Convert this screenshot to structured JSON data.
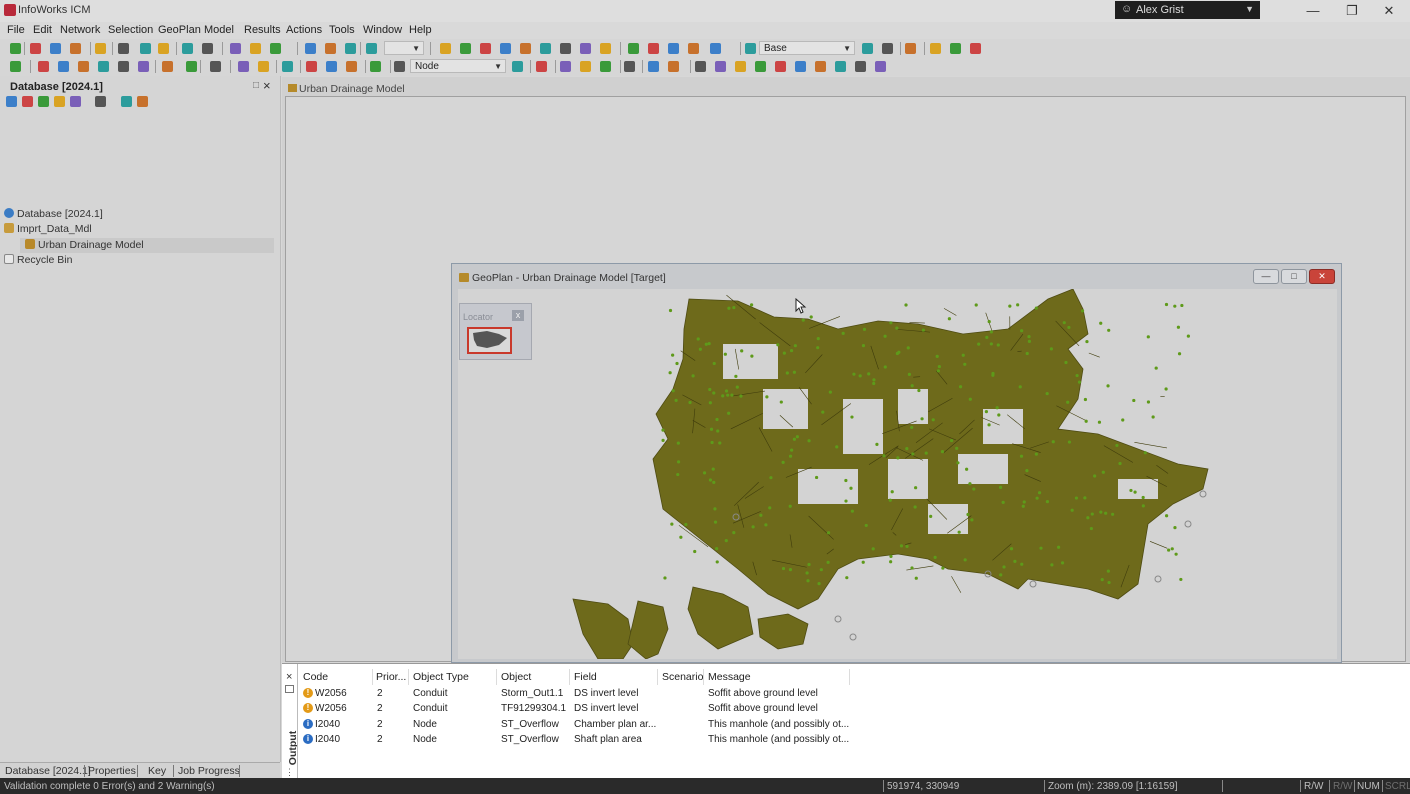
{
  "titlebar": {
    "title": "InfoWorks ICM",
    "user": "Alex Grist",
    "controls": [
      "—",
      "❐",
      "✕"
    ]
  },
  "menu": [
    "File",
    "Edit",
    "Network",
    "Selection",
    "GeoPlan",
    "Model",
    "Results",
    "Actions",
    "Tools",
    "Window",
    "Help"
  ],
  "toolbar": {
    "scenario_combo": "Base",
    "type_combo": "Node"
  },
  "database_panel": {
    "title": "Database [2024.1]",
    "tree": [
      {
        "label": "Database [2024.1]",
        "icon": "database-icon"
      },
      {
        "label": "Imprt_Data_Mdl",
        "icon": "folder-icon"
      },
      {
        "label": "Urban Drainage Model",
        "icon": "model-group-icon",
        "selected": true
      },
      {
        "label": "Recycle Bin",
        "icon": "recycle-bin-icon"
      }
    ],
    "tabs": [
      "Database [2024.1]",
      "Properties",
      "Key",
      "Job Progress"
    ]
  },
  "document_tab": "Urban Drainage Model",
  "geoplan": {
    "title": "GeoPlan - Urban Drainage Model [Target]",
    "locator_label": "Locator",
    "map_color": "#6e6a1b",
    "node_color": "#5e9a1a"
  },
  "output": {
    "label": "Output",
    "columns": [
      "Code",
      "Prior...",
      "Object Type",
      "Object",
      "Field",
      "Scenario",
      "Message"
    ],
    "rows": [
      {
        "icon": "warning-icon",
        "code": "W2056",
        "priority": "2",
        "object_type": "Conduit",
        "object": "Storm_Out1.1",
        "field": "DS invert level",
        "scenario": "",
        "message": "Soffit above ground level"
      },
      {
        "icon": "warning-icon",
        "code": "W2056",
        "priority": "2",
        "object_type": "Conduit",
        "object": "TF91299304.1",
        "field": "DS invert level",
        "scenario": "",
        "message": "Soffit above ground level"
      },
      {
        "icon": "info-icon",
        "code": "I2040",
        "priority": "2",
        "object_type": "Node",
        "object": "ST_Overflow",
        "field": "Chamber plan ar...",
        "scenario": "",
        "message": "This manhole (and possibly ot..."
      },
      {
        "icon": "info-icon",
        "code": "I2040",
        "priority": "2",
        "object_type": "Node",
        "object": "ST_Overflow",
        "field": "Shaft plan area",
        "scenario": "",
        "message": "This manhole (and possibly ot..."
      }
    ]
  },
  "statusbar": {
    "message": "Validation complete 0 Error(s) and 2 Warning(s)",
    "coords": "591974, 330949",
    "zoom": "Zoom (m): 2389.09 [1:16159]",
    "rw": "R/W",
    "rw2": "R/W",
    "num": "NUM",
    "scrl": "SCRL"
  }
}
